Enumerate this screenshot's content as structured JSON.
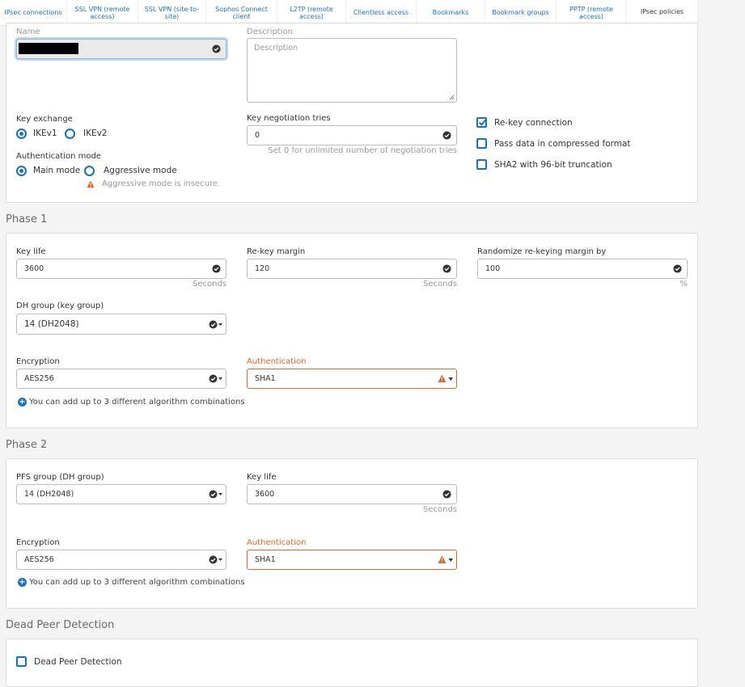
{
  "tabs": [
    {
      "label": "IPsec connections"
    },
    {
      "label": "SSL VPN (remote access)"
    },
    {
      "label": "SSL VPN (site-to-site)"
    },
    {
      "label": "Sophos Connect client"
    },
    {
      "label": "L2TP (remote access)"
    },
    {
      "label": "Clientless access"
    },
    {
      "label": "Bookmarks"
    },
    {
      "label": "Bookmark groups"
    },
    {
      "label": "PPTP (remote access)"
    },
    {
      "label": "IPsec policies"
    }
  ],
  "general": {
    "name_label": "Name",
    "description_label": "Description",
    "description_placeholder": "Description",
    "key_exchange_label": "Key exchange",
    "ikev1": "IKEv1",
    "ikev2": "IKEv2",
    "auth_mode_label": "Authentication mode",
    "main_mode": "Main mode",
    "aggressive_mode": "Aggressive mode",
    "aggressive_warning": "Aggressive mode is insecure",
    "key_neg_label": "Key negotiation tries",
    "key_neg_value": "0",
    "key_neg_hint": "Set 0 for unlimited number of negotiation tries",
    "rekey_connection": "Re-key connection",
    "pass_compressed": "Pass data in compressed format",
    "sha2_trunc": "SHA2 with 96-bit truncation"
  },
  "phase1": {
    "title": "Phase 1",
    "key_life_label": "Key life",
    "key_life_value": "3600",
    "key_life_unit": "Seconds",
    "rekey_margin_label": "Re-key margin",
    "rekey_margin_value": "120",
    "rekey_margin_unit": "Seconds",
    "randomize_label": "Randomize re-keying margin by",
    "randomize_value": "100",
    "randomize_unit": "%",
    "dh_label": "DH group (key group)",
    "dh_value": "14 (DH2048)",
    "enc_label": "Encryption",
    "enc_value": "AES256",
    "auth_label": "Authentication",
    "auth_value": "SHA1",
    "add_text": "You can add up to 3 different algorithm combinations"
  },
  "phase2": {
    "title": "Phase 2",
    "pfs_label": "PFS group (DH group)",
    "pfs_value": "14 (DH2048)",
    "key_life_label": "Key life",
    "key_life_value": "3600",
    "key_life_unit": "Seconds",
    "enc_label": "Encryption",
    "enc_value": "AES256",
    "auth_label": "Authentication",
    "auth_value": "SHA1",
    "add_text": "You can add up to 3 different algorithm combinations"
  },
  "dpd": {
    "title": "Dead Peer Detection",
    "checkbox_label": "Dead Peer Detection"
  },
  "colors": {
    "accent": "#1a73b8",
    "warning": "#e1662a"
  }
}
